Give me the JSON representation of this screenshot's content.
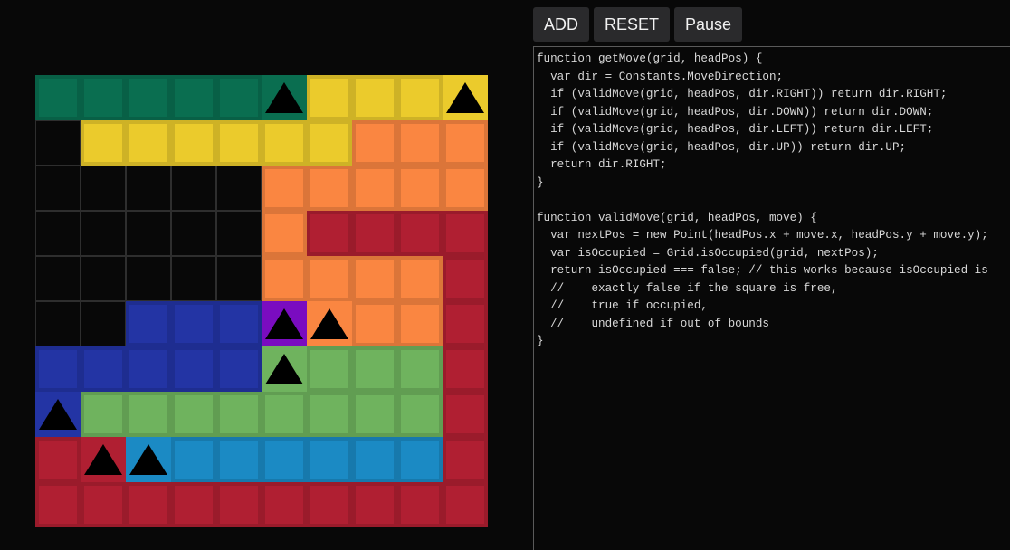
{
  "toolbar": {
    "add_label": "ADD",
    "reset_label": "RESET",
    "pause_label": "Pause"
  },
  "board": {
    "cols": 10,
    "rows": 10,
    "empty_color": "#080808",
    "grid_line_color": "#2e2e2e",
    "snakes": [
      {
        "name": "teal",
        "color": "#0a6e50",
        "head": [
          5,
          0
        ],
        "cells": [
          [
            0,
            0
          ],
          [
            1,
            0
          ],
          [
            2,
            0
          ],
          [
            3,
            0
          ],
          [
            4,
            0
          ],
          [
            5,
            0
          ]
        ]
      },
      {
        "name": "yellow",
        "color": "#ebcb2c",
        "head": [
          9,
          0
        ],
        "cells": [
          [
            6,
            0
          ],
          [
            7,
            0
          ],
          [
            8,
            0
          ],
          [
            9,
            0
          ],
          [
            1,
            1
          ],
          [
            2,
            1
          ],
          [
            3,
            1
          ],
          [
            4,
            1
          ],
          [
            5,
            1
          ],
          [
            6,
            1
          ]
        ]
      },
      {
        "name": "orange",
        "color": "#fa8641",
        "head": [
          6,
          5
        ],
        "cells": [
          [
            7,
            1
          ],
          [
            8,
            1
          ],
          [
            9,
            1
          ],
          [
            5,
            2
          ],
          [
            6,
            2
          ],
          [
            7,
            2
          ],
          [
            8,
            2
          ],
          [
            9,
            2
          ],
          [
            5,
            3
          ],
          [
            5,
            4
          ],
          [
            6,
            4
          ],
          [
            7,
            4
          ],
          [
            8,
            4
          ],
          [
            7,
            5
          ],
          [
            8,
            5
          ],
          [
            6,
            5
          ]
        ]
      },
      {
        "name": "red",
        "color": "#b01f32",
        "head": [
          1,
          8
        ],
        "cells": [
          [
            6,
            3
          ],
          [
            7,
            3
          ],
          [
            8,
            3
          ],
          [
            9,
            3
          ],
          [
            9,
            4
          ],
          [
            9,
            5
          ],
          [
            9,
            6
          ],
          [
            9,
            7
          ],
          [
            9,
            8
          ],
          [
            0,
            8
          ],
          [
            1,
            8
          ],
          [
            0,
            9
          ],
          [
            1,
            9
          ],
          [
            2,
            9
          ],
          [
            3,
            9
          ],
          [
            4,
            9
          ],
          [
            5,
            9
          ],
          [
            6,
            9
          ],
          [
            7,
            9
          ],
          [
            8,
            9
          ],
          [
            9,
            9
          ]
        ]
      },
      {
        "name": "purple",
        "color": "#7a0cc0",
        "head": [
          5,
          5
        ],
        "cells": [
          [
            5,
            5
          ]
        ]
      },
      {
        "name": "blue",
        "color": "#2334a4",
        "head": [
          0,
          7
        ],
        "cells": [
          [
            2,
            5
          ],
          [
            3,
            5
          ],
          [
            4,
            5
          ],
          [
            0,
            6
          ],
          [
            1,
            6
          ],
          [
            2,
            6
          ],
          [
            3,
            6
          ],
          [
            4,
            6
          ],
          [
            0,
            7
          ]
        ]
      },
      {
        "name": "green",
        "color": "#6fb35e",
        "head": [
          5,
          6
        ],
        "cells": [
          [
            5,
            6
          ],
          [
            6,
            6
          ],
          [
            7,
            6
          ],
          [
            8,
            6
          ],
          [
            1,
            7
          ],
          [
            2,
            7
          ],
          [
            3,
            7
          ],
          [
            4,
            7
          ],
          [
            5,
            7
          ],
          [
            6,
            7
          ],
          [
            7,
            7
          ],
          [
            8,
            7
          ]
        ]
      },
      {
        "name": "cyan",
        "color": "#1b8ac4",
        "head": [
          2,
          8
        ],
        "cells": [
          [
            2,
            8
          ],
          [
            3,
            8
          ],
          [
            4,
            8
          ],
          [
            5,
            8
          ],
          [
            6,
            8
          ],
          [
            7,
            8
          ],
          [
            8,
            8
          ]
        ]
      }
    ]
  },
  "editor": {
    "lines": [
      "function getMove(grid, headPos) {",
      "  var dir = Constants.MoveDirection;",
      "  if (validMove(grid, headPos, dir.RIGHT)) return dir.RIGHT;",
      "  if (validMove(grid, headPos, dir.DOWN)) return dir.DOWN;",
      "  if (validMove(grid, headPos, dir.LEFT)) return dir.LEFT;",
      "  if (validMove(grid, headPos, dir.UP)) return dir.UP;",
      "  return dir.RIGHT;",
      "}",
      "",
      "function validMove(grid, headPos, move) {",
      "  var nextPos = new Point(headPos.x + move.x, headPos.y + move.y);",
      "  var isOccupied = Grid.isOccupied(grid, nextPos);",
      "  return isOccupied === false; // this works because isOccupied is",
      "  //    exactly false if the square is free,",
      "  //    true if occupied,",
      "  //    undefined if out of bounds",
      "}"
    ]
  }
}
